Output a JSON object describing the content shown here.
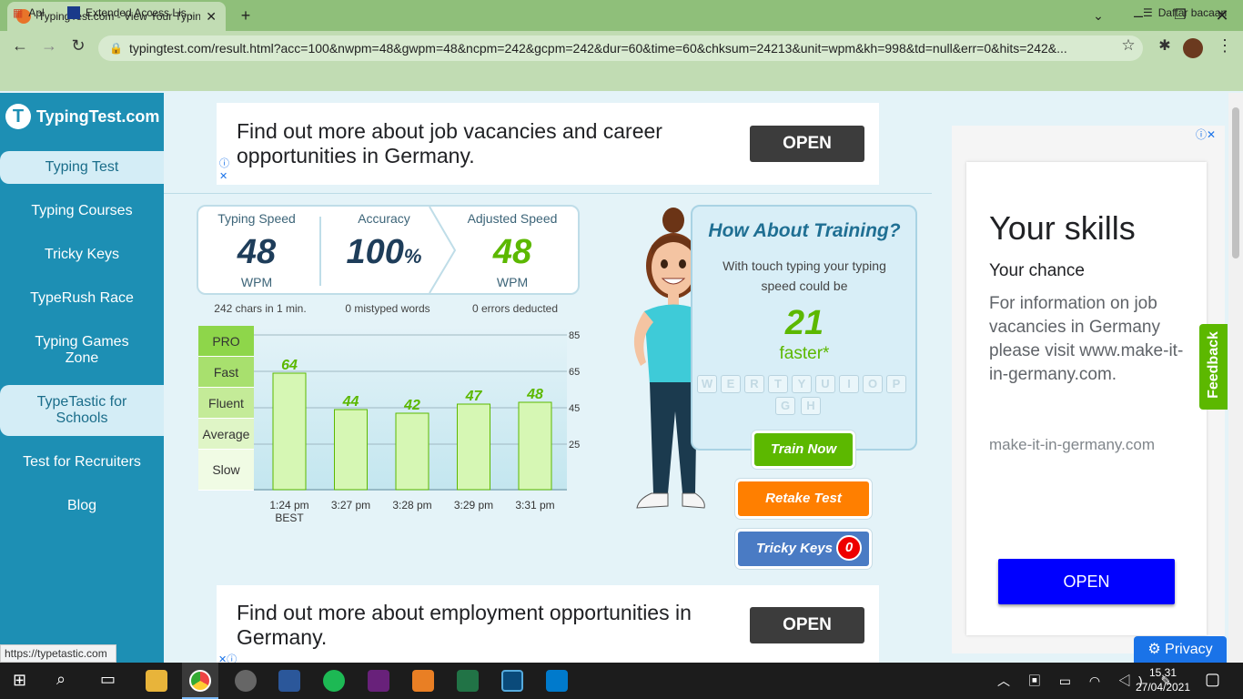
{
  "browser": {
    "tab_title": "TypingTest.com - View Your Typin",
    "url": "typingtest.com/result.html?acc=100&nwpm=48&gwpm=48&ncpm=242&gcpm=242&dur=60&time=60&chksum=24213&unit=wpm&kh=998&td=null&err=0&hits=242&...",
    "bookmarks": [
      "Apl",
      "Extended Access Lis..."
    ],
    "reading_list": "Daftar bacaan"
  },
  "sidebar": {
    "logo": "TypingTest.com",
    "items": [
      "Typing Test",
      "Typing Courses",
      "Tricky Keys",
      "TypeRush Race",
      "Typing Games Zone",
      "TypeTastic for Schools",
      "Test for Recruiters",
      "Blog"
    ]
  },
  "status_url": "https://typetastic.com",
  "top_ad": {
    "text": "Find out more about job vacancies and career opportunities in Germany.",
    "button": "OPEN"
  },
  "bottom_ad": {
    "text": "Find out more about employment opportunities in Germany.",
    "button": "OPEN"
  },
  "stats": {
    "speed": {
      "label": "Typing Speed",
      "value": "48",
      "unit": "WPM",
      "note": "242 chars in 1 min."
    },
    "accuracy": {
      "label": "Accuracy",
      "value": "100",
      "unit": "%",
      "note": "0 mistyped words"
    },
    "adjusted": {
      "label": "Adjusted Speed",
      "value": "48",
      "unit": "WPM",
      "note": "0 errors deducted"
    }
  },
  "levels": [
    "PRO",
    "Fast",
    "Fluent",
    "Average",
    "Slow"
  ],
  "chart_data": {
    "type": "bar",
    "categories": [
      "1:24 pm",
      "3:27 pm",
      "3:28 pm",
      "3:29 pm",
      "3:31 pm"
    ],
    "category_sublabels": [
      "BEST",
      "",
      "",
      "",
      ""
    ],
    "values": [
      64,
      44,
      42,
      47,
      48
    ],
    "yticks": [
      85,
      65,
      45,
      25
    ],
    "ylim": [
      0,
      90
    ],
    "grid": true,
    "bar_color": "#d6f7b4"
  },
  "training": {
    "title": "How About Training?",
    "text": "With touch typing your typing speed could be",
    "value": "21",
    "suffix": "faster*",
    "keys": [
      "W",
      "E",
      "R",
      "T",
      "Y",
      "U",
      "I",
      "O",
      "P",
      "G",
      "H"
    ],
    "train_btn": "Train Now",
    "retake_btn": "Retake Test",
    "tricky_btn": "Tricky Keys",
    "tricky_count": "0"
  },
  "right_ad": {
    "headline": "Your skills",
    "sub": "Your chance",
    "body": "For information on job vacancies in Germany please visit www.make-it-in-germany.com.",
    "domain": "make-it-in-germany.com",
    "button": "OPEN"
  },
  "feedback": "Feedback",
  "privacy": "Privacy",
  "taskbar": {
    "time": "15.31",
    "date": "27/04/2021"
  },
  "colors": {
    "sidebar": "#1d8fb4",
    "accent_green": "#5cb800",
    "orange": "#ff7f00",
    "blue_btn": "#4a7bc4",
    "ad_blue": "#0000ff"
  }
}
